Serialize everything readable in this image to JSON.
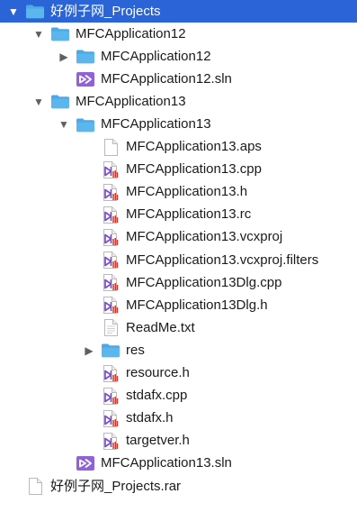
{
  "colors": {
    "selection": "#2a64d6",
    "folder": "#5bb6ee",
    "vs_purple": "#7a4fc2",
    "doc_red": "#c83a2a"
  },
  "tree": [
    {
      "label": "好例子网_Projects",
      "icon": "folder-icon",
      "arrow": "expanded",
      "selected": true
    },
    {
      "label": "MFCApplication12",
      "icon": "folder-icon",
      "arrow": "expanded"
    },
    {
      "label": "MFCApplication12",
      "icon": "folder-icon",
      "arrow": "collapsed"
    },
    {
      "label": "MFCApplication12.sln",
      "icon": "visual-studio-solution-icon"
    },
    {
      "label": "MFCApplication13",
      "icon": "folder-icon",
      "arrow": "expanded"
    },
    {
      "label": "MFCApplication13",
      "icon": "folder-icon",
      "arrow": "expanded"
    },
    {
      "label": "MFCApplication13.aps",
      "icon": "blank-file-icon"
    },
    {
      "label": "MFCApplication13.cpp",
      "icon": "visual-studio-file-icon"
    },
    {
      "label": "MFCApplication13.h",
      "icon": "visual-studio-file-icon"
    },
    {
      "label": "MFCApplication13.rc",
      "icon": "visual-studio-file-icon"
    },
    {
      "label": "MFCApplication13.vcxproj",
      "icon": "visual-studio-file-icon"
    },
    {
      "label": "MFCApplication13.vcxproj.filters",
      "icon": "visual-studio-file-icon"
    },
    {
      "label": "MFCApplication13Dlg.cpp",
      "icon": "visual-studio-file-icon"
    },
    {
      "label": "MFCApplication13Dlg.h",
      "icon": "visual-studio-file-icon"
    },
    {
      "label": "ReadMe.txt",
      "icon": "text-file-icon"
    },
    {
      "label": "res",
      "icon": "folder-icon",
      "arrow": "collapsed"
    },
    {
      "label": "resource.h",
      "icon": "visual-studio-file-icon"
    },
    {
      "label": "stdafx.cpp",
      "icon": "visual-studio-file-icon"
    },
    {
      "label": "stdafx.h",
      "icon": "visual-studio-file-icon"
    },
    {
      "label": "targetver.h",
      "icon": "visual-studio-file-icon"
    },
    {
      "label": "MFCApplication13.sln",
      "icon": "visual-studio-solution-icon"
    },
    {
      "label": "好例子网_Projects.rar",
      "icon": "blank-file-icon"
    }
  ]
}
